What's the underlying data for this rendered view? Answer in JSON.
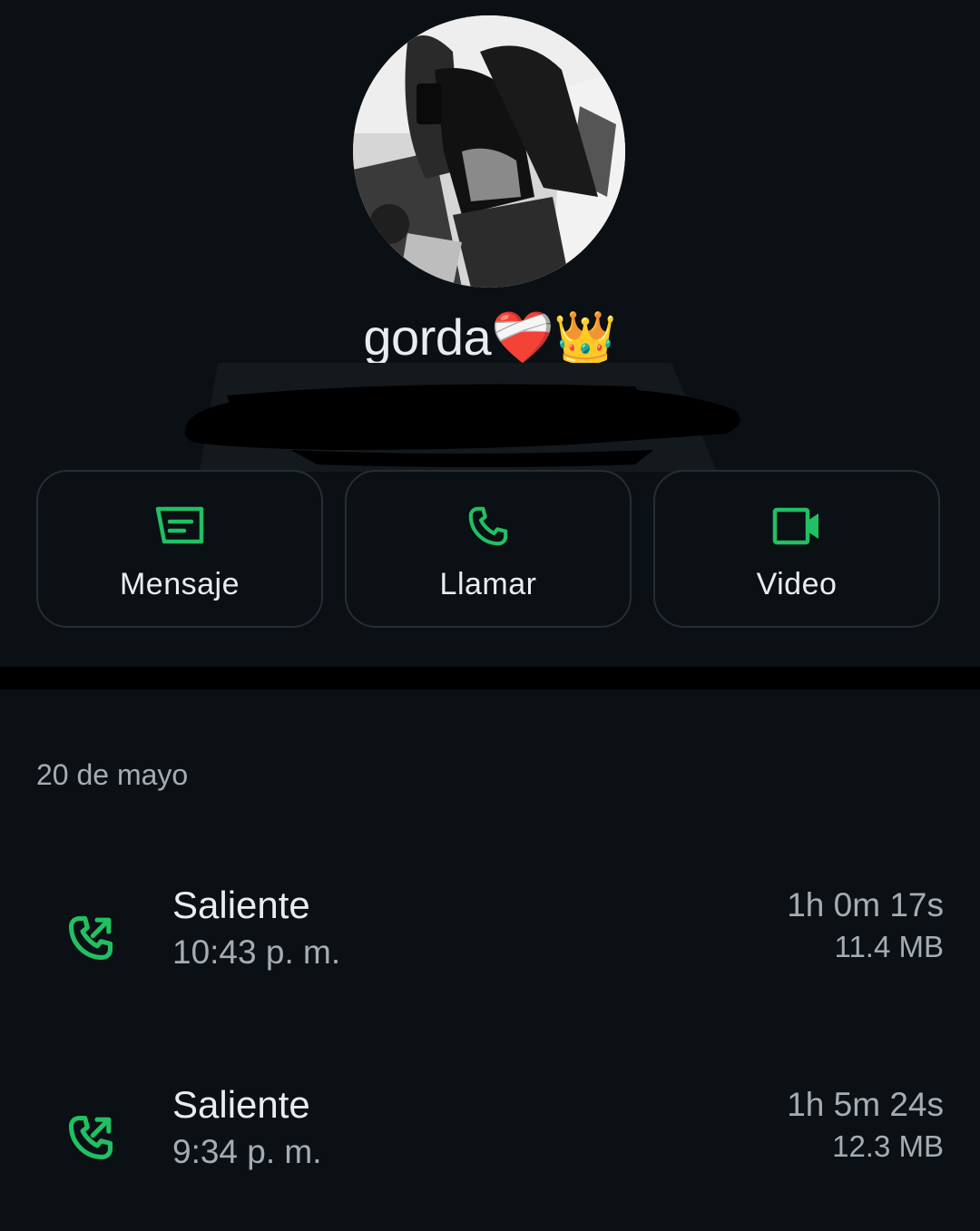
{
  "contact": {
    "name": "gorda❤️‍🩹👑"
  },
  "actions": [
    {
      "label": "Mensaje",
      "icon": "message-icon"
    },
    {
      "label": "Llamar",
      "icon": "phone-icon"
    },
    {
      "label": "Video",
      "icon": "video-camera-icon"
    }
  ],
  "history": {
    "date": "20 de mayo",
    "calls": [
      {
        "type": "Saliente",
        "time": "10:43 p. m.",
        "duration": "1h 0m 17s",
        "size": "11.4 MB",
        "icon": "outgoing-call-icon"
      },
      {
        "type": "Saliente",
        "time": "9:34 p. m.",
        "duration": "1h 5m 24s",
        "size": "12.3 MB",
        "icon": "outgoing-call-icon"
      }
    ]
  },
  "colors": {
    "background": "#0b1014",
    "accent": "#21c063",
    "text_primary": "#e9edef",
    "text_secondary": "#a5adb2",
    "button_border": "#262e33"
  }
}
